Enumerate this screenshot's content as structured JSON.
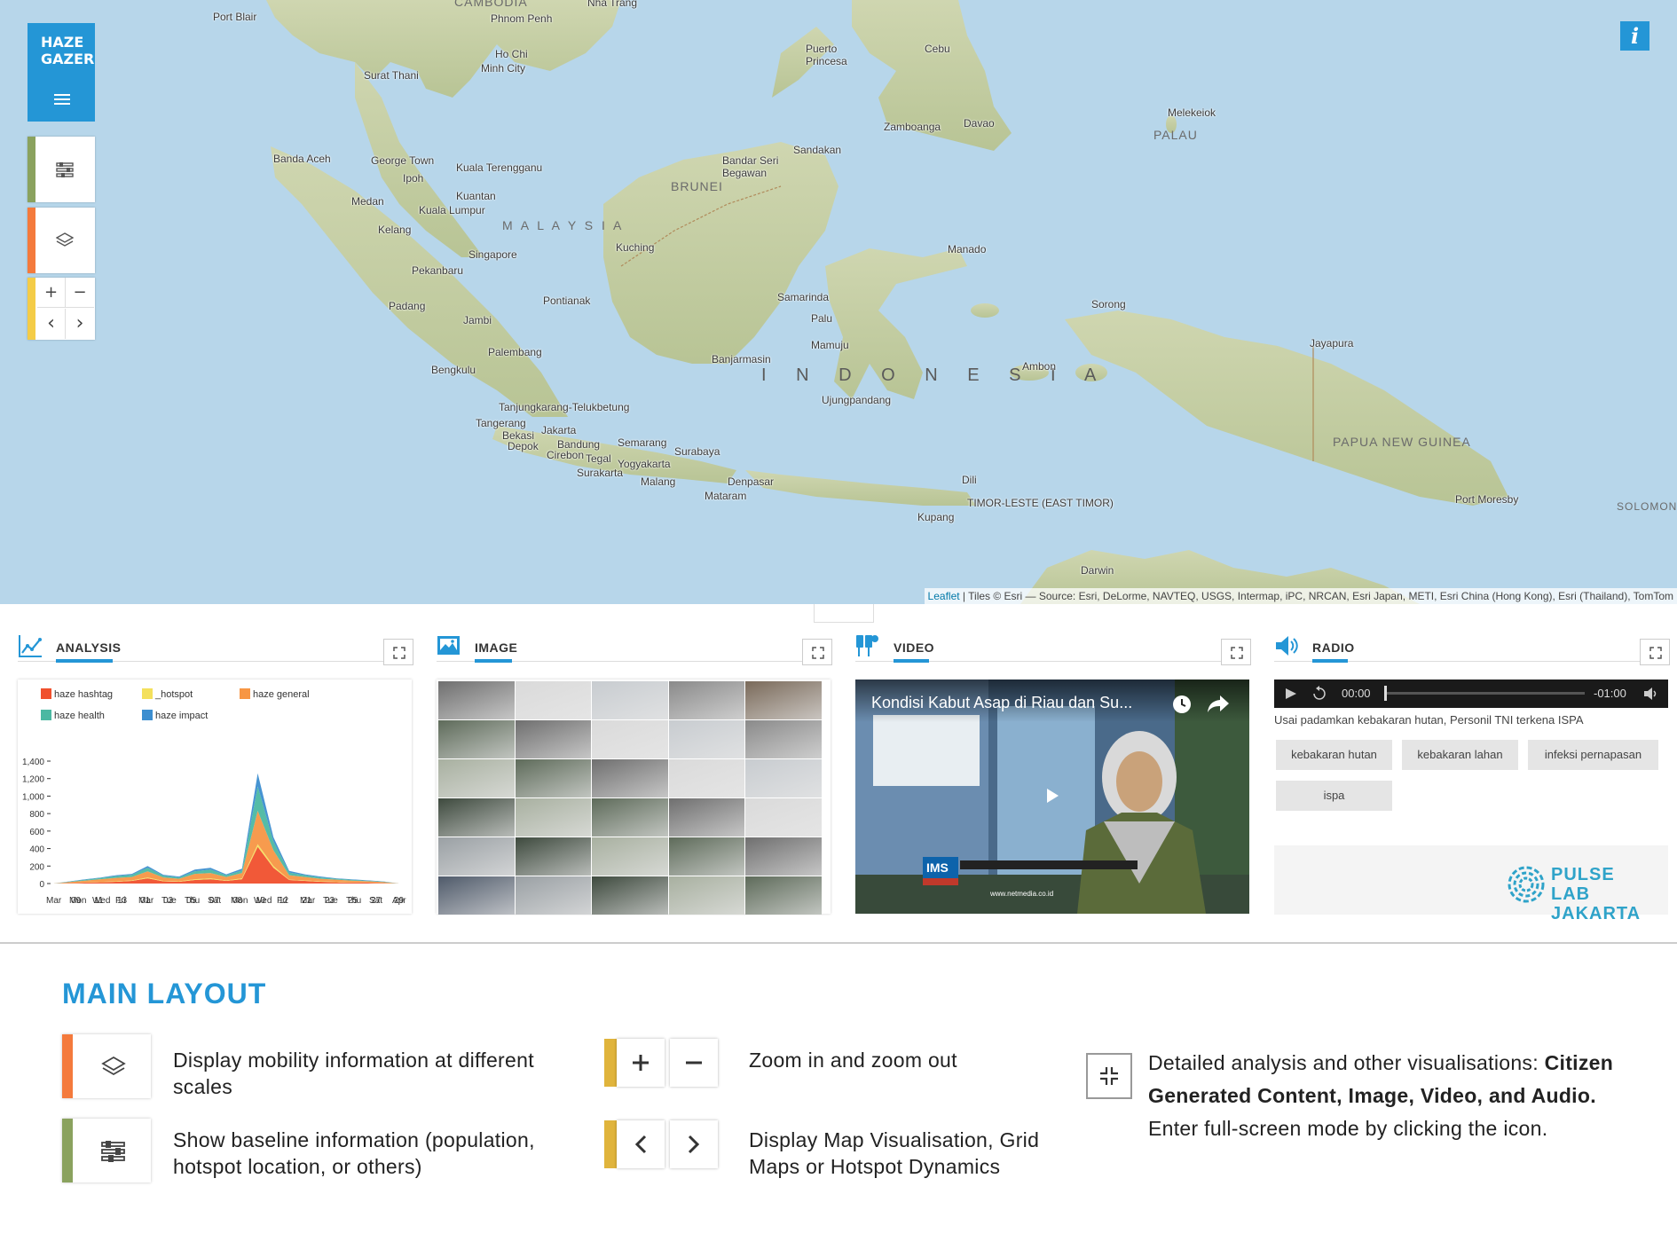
{
  "app": {
    "logo_line1": "HAZE",
    "logo_line2": "GAZER",
    "info_label": "i"
  },
  "map": {
    "attribution_link": "Leaflet",
    "attribution_text": " | Tiles © Esri — Source: Esri, DeLorme, NAVTEQ, USGS, Intermap, iPC, NRCAN, Esri Japan, METI, Esri China (Hong Kong), Esri (Thailand), TomTom",
    "zoom_in": "+",
    "zoom_out": "−",
    "prev": "‹",
    "next": "›",
    "big_label": "I N D O N E S I A",
    "labels": {
      "cambodia": "CAMBODIA",
      "nha_trang": "Nha Trang",
      "phnom_penh": "Phnom Penh",
      "port_blair": "Port Blair",
      "ho_chi_minh_1": "Ho Chi",
      "ho_chi_minh_2": "Minh City",
      "surat_thani": "Surat Thani",
      "puerto_princesa_1": "Puerto",
      "puerto_princesa_2": "Princesa",
      "cebu": "Cebu",
      "zamboanga": "Zamboanga",
      "davao": "Davao",
      "melekeiok": "Melekeiok",
      "palau": "PALAU",
      "banda_aceh": "Banda Aceh",
      "george_town": "George Town",
      "ipoh": "Ipoh",
      "kuala_terengganu": "Kuala Terengganu",
      "kuantan": "Kuantan",
      "medan": "Medan",
      "kuala_lumpur": "Kuala Lumpur",
      "klang": "Kelang",
      "malaysia": "M A L A Y S I A",
      "bandar_seri_1": "Bandar Seri",
      "bandar_seri_2": "Begawan",
      "brunei": "BRUNEI",
      "sandakan": "Sandakan",
      "singapore": "Singapore",
      "pekanbaru": "Pekanbaru",
      "kuching": "Kuching",
      "manado": "Manado",
      "padang": "Padang",
      "jambi": "Jambi",
      "pontianak": "Pontianak",
      "samarinda": "Samarinda",
      "palu": "Palu",
      "sorong": "Sorong",
      "jayapura": "Jayapura",
      "palembang": "Palembang",
      "mamuju": "Mamuju",
      "banjarmasin": "Banjarmasin",
      "bengkulu": "Bengkulu",
      "ambon": "Ambon",
      "ujungpandang": "Ujungpandang",
      "tanjungkarang": "Tanjungkarang-Telukbetung",
      "tangerang": "Tangerang",
      "bekasi": "Bekasi",
      "jakarta": "Jakarta",
      "depok": "Depok",
      "bandung": "Bandung",
      "semarang": "Semarang",
      "surabaya": "Surabaya",
      "cirebon": "Cirebon",
      "tegal": "Tegal",
      "yogyakarta": "Yogyakarta",
      "surakarta": "Surakarta",
      "malang": "Malang",
      "denpasar": "Denpasar",
      "mataram": "Mataram",
      "dili": "Dili",
      "timor_leste": "TIMOR-LESTE (EAST TIMOR)",
      "kupang": "Kupang",
      "png": "PAPUA NEW GUINEA",
      "port_moresby": "Port Moresby",
      "solomon": "SOLOMON",
      "darwin": "Darwin"
    }
  },
  "panels": {
    "analysis": {
      "title": "ANALYSIS"
    },
    "image": {
      "title": "IMAGE"
    },
    "video": {
      "title": "VIDEO",
      "caption": "Kondisi Kabut Asap di Riau dan Su...",
      "channel": "IMS",
      "site": "www.netmedia.co.id"
    },
    "radio": {
      "title": "RADIO",
      "time_elapsed": "00:00",
      "time_remaining": "-01:00",
      "track_title": "Usai padamkan kebakaran hutan, Personil TNI terkena ISPA",
      "tags": [
        "kebakaran hutan",
        "kebakaran lahan",
        "infeksi pernapasan",
        "ispa"
      ],
      "partner_line1": "PULSE",
      "partner_line2": "LAB JAKARTA"
    }
  },
  "chart_data": {
    "type": "area",
    "title": "",
    "series": [
      {
        "name": "haze hashtag",
        "color": "#f0502d",
        "values": [
          0,
          5,
          10,
          15,
          20,
          30,
          60,
          25,
          20,
          40,
          50,
          30,
          50,
          420,
          180,
          40,
          30,
          20,
          15,
          10,
          10,
          5,
          0
        ]
      },
      {
        "name": "_hotspot",
        "color": "#f4e05c",
        "values": [
          0,
          2,
          3,
          4,
          5,
          5,
          10,
          5,
          5,
          10,
          10,
          5,
          10,
          30,
          20,
          5,
          5,
          5,
          5,
          3,
          2,
          2,
          0
        ]
      },
      {
        "name": "haze general",
        "color": "#f79644",
        "values": [
          0,
          10,
          20,
          30,
          40,
          40,
          70,
          40,
          30,
          60,
          60,
          40,
          60,
          380,
          180,
          50,
          40,
          30,
          25,
          20,
          15,
          10,
          0
        ]
      },
      {
        "name": "haze health",
        "color": "#4cb8a2",
        "values": [
          0,
          5,
          10,
          15,
          20,
          25,
          40,
          20,
          15,
          30,
          40,
          20,
          30,
          280,
          100,
          30,
          20,
          15,
          10,
          10,
          5,
          5,
          0
        ]
      },
      {
        "name": "haze impact",
        "color": "#3c8ed0",
        "values": [
          0,
          2,
          5,
          5,
          10,
          10,
          20,
          10,
          10,
          20,
          20,
          10,
          20,
          150,
          50,
          20,
          10,
          10,
          5,
          5,
          5,
          2,
          0
        ]
      }
    ],
    "x_tick_labels": [
      "Mar",
      "Mon",
      "Wed",
      "Fri",
      "Mar",
      "Tue",
      "Thu",
      "Sat",
      "Mon",
      "Wed",
      "Fri",
      "Mar",
      "Tue",
      "Thu",
      "Sat",
      "Apr"
    ],
    "x_tick_labels_2": [
      "",
      "09",
      "11",
      "13",
      "01",
      "03",
      "05",
      "07",
      "08",
      "10",
      "12",
      "21",
      "23",
      "25",
      "27",
      "29"
    ],
    "y_ticks": [
      "0",
      "200",
      "400",
      "600",
      "800",
      "1,000",
      "1,200",
      "1,400"
    ],
    "ylim": [
      0,
      1400
    ],
    "legend_position": "top-left"
  },
  "main_layout": {
    "title": "MAIN LAYOUT",
    "item1": "Display mobility information at different scales",
    "item2": "Show baseline information (population, hotspot location, or others)",
    "item3": "Zoom in and zoom out",
    "item4": "Display Map Visualisation, Grid Maps or Hotspot Dynamics",
    "item5_pre": "Detailed analysis and other visualisations: ",
    "item5_bold": "Citizen Generated Content, Image, Video, and Audio.",
    "item5_post": "Enter full-screen mode by clicking the icon."
  },
  "colors": {
    "accent": "#2496d6",
    "layers_bar": "#f47a3c",
    "baseline_bar": "#8aa25e",
    "zoom_bar": "#f4cc47"
  }
}
